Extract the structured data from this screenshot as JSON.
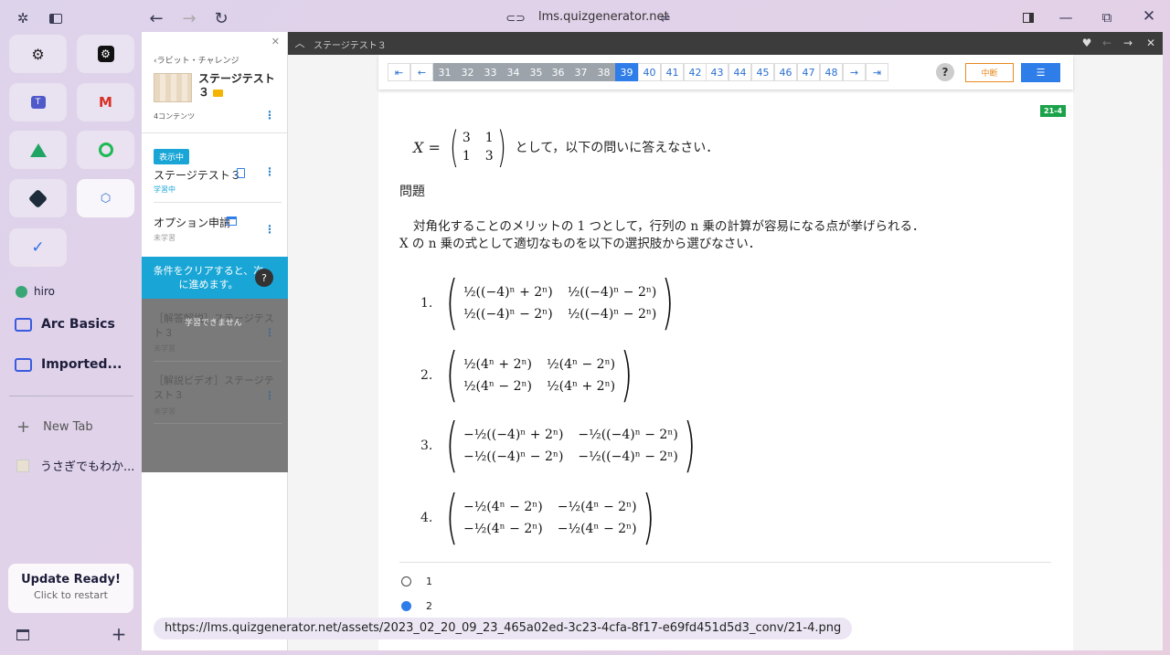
{
  "browser": {
    "url": "lms.quizgenerator.net",
    "status_url": "https://lms.quizgenerator.net/assets/2023_02_20_09_23_465a02ed-3c23-4cfa-8f17-e69fd451d5d3_conv/21-4.png"
  },
  "sidebar": {
    "profile": "hiro",
    "folders": [
      "Arc Basics",
      "Imported..."
    ],
    "new_tab": "New Tab",
    "tab_title": "うさぎでもわか...",
    "update_title": "Update Ready!",
    "update_sub": "Click to restart"
  },
  "panel": {
    "breadcrumb": "‹ラビット・チャレンジ",
    "title": "ステージテスト\n３",
    "count": "4コンテンツ",
    "badge": "表示中",
    "items": [
      {
        "title": "ステージテスト３",
        "status": "学習中"
      },
      {
        "title": "オプション申請",
        "status": "未学習"
      },
      {
        "title": "［解答解説］ステージテスト３",
        "status": "未学習"
      },
      {
        "title": "［解説ビデオ］ステージテスト３",
        "status": "未学習"
      }
    ],
    "notice": "条件をクリアすると、次に進めます。",
    "overlay": "学習できません"
  },
  "viewer": {
    "title": "ステージテスト３",
    "pages": [
      "31",
      "32",
      "33",
      "34",
      "35",
      "36",
      "37",
      "38",
      "39",
      "40",
      "41",
      "42",
      "43",
      "44",
      "45",
      "46",
      "47",
      "48"
    ],
    "active": "39",
    "suspend": "中断",
    "tag": "21-4"
  },
  "question": {
    "intro": "として，以下の問いに答えなさい．",
    "heading": "問題",
    "line1": "対角化することのメリットの 1 つとして，行列の n 乗の計算が容易になる点が挙げられる．",
    "line2": "X の n 乗の式として適切なものを以下の選択肢から選びなさい．",
    "choices": [
      "1",
      "2"
    ],
    "selected": "2"
  }
}
